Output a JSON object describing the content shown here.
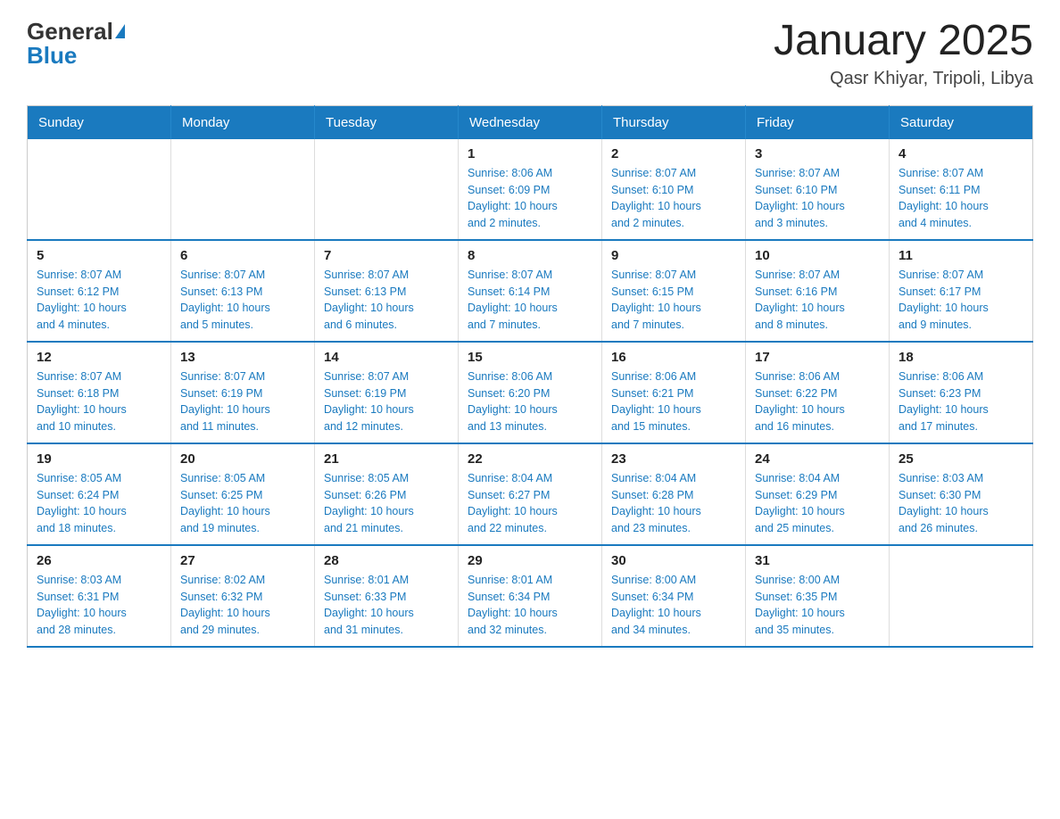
{
  "logo": {
    "text_general": "General",
    "text_blue": "Blue"
  },
  "header": {
    "title": "January 2025",
    "subtitle": "Qasr Khiyar, Tripoli, Libya"
  },
  "weekdays": [
    "Sunday",
    "Monday",
    "Tuesday",
    "Wednesday",
    "Thursday",
    "Friday",
    "Saturday"
  ],
  "weeks": [
    [
      {
        "day": "",
        "info": ""
      },
      {
        "day": "",
        "info": ""
      },
      {
        "day": "",
        "info": ""
      },
      {
        "day": "1",
        "info": "Sunrise: 8:06 AM\nSunset: 6:09 PM\nDaylight: 10 hours\nand 2 minutes."
      },
      {
        "day": "2",
        "info": "Sunrise: 8:07 AM\nSunset: 6:10 PM\nDaylight: 10 hours\nand 2 minutes."
      },
      {
        "day": "3",
        "info": "Sunrise: 8:07 AM\nSunset: 6:10 PM\nDaylight: 10 hours\nand 3 minutes."
      },
      {
        "day": "4",
        "info": "Sunrise: 8:07 AM\nSunset: 6:11 PM\nDaylight: 10 hours\nand 4 minutes."
      }
    ],
    [
      {
        "day": "5",
        "info": "Sunrise: 8:07 AM\nSunset: 6:12 PM\nDaylight: 10 hours\nand 4 minutes."
      },
      {
        "day": "6",
        "info": "Sunrise: 8:07 AM\nSunset: 6:13 PM\nDaylight: 10 hours\nand 5 minutes."
      },
      {
        "day": "7",
        "info": "Sunrise: 8:07 AM\nSunset: 6:13 PM\nDaylight: 10 hours\nand 6 minutes."
      },
      {
        "day": "8",
        "info": "Sunrise: 8:07 AM\nSunset: 6:14 PM\nDaylight: 10 hours\nand 7 minutes."
      },
      {
        "day": "9",
        "info": "Sunrise: 8:07 AM\nSunset: 6:15 PM\nDaylight: 10 hours\nand 7 minutes."
      },
      {
        "day": "10",
        "info": "Sunrise: 8:07 AM\nSunset: 6:16 PM\nDaylight: 10 hours\nand 8 minutes."
      },
      {
        "day": "11",
        "info": "Sunrise: 8:07 AM\nSunset: 6:17 PM\nDaylight: 10 hours\nand 9 minutes."
      }
    ],
    [
      {
        "day": "12",
        "info": "Sunrise: 8:07 AM\nSunset: 6:18 PM\nDaylight: 10 hours\nand 10 minutes."
      },
      {
        "day": "13",
        "info": "Sunrise: 8:07 AM\nSunset: 6:19 PM\nDaylight: 10 hours\nand 11 minutes."
      },
      {
        "day": "14",
        "info": "Sunrise: 8:07 AM\nSunset: 6:19 PM\nDaylight: 10 hours\nand 12 minutes."
      },
      {
        "day": "15",
        "info": "Sunrise: 8:06 AM\nSunset: 6:20 PM\nDaylight: 10 hours\nand 13 minutes."
      },
      {
        "day": "16",
        "info": "Sunrise: 8:06 AM\nSunset: 6:21 PM\nDaylight: 10 hours\nand 15 minutes."
      },
      {
        "day": "17",
        "info": "Sunrise: 8:06 AM\nSunset: 6:22 PM\nDaylight: 10 hours\nand 16 minutes."
      },
      {
        "day": "18",
        "info": "Sunrise: 8:06 AM\nSunset: 6:23 PM\nDaylight: 10 hours\nand 17 minutes."
      }
    ],
    [
      {
        "day": "19",
        "info": "Sunrise: 8:05 AM\nSunset: 6:24 PM\nDaylight: 10 hours\nand 18 minutes."
      },
      {
        "day": "20",
        "info": "Sunrise: 8:05 AM\nSunset: 6:25 PM\nDaylight: 10 hours\nand 19 minutes."
      },
      {
        "day": "21",
        "info": "Sunrise: 8:05 AM\nSunset: 6:26 PM\nDaylight: 10 hours\nand 21 minutes."
      },
      {
        "day": "22",
        "info": "Sunrise: 8:04 AM\nSunset: 6:27 PM\nDaylight: 10 hours\nand 22 minutes."
      },
      {
        "day": "23",
        "info": "Sunrise: 8:04 AM\nSunset: 6:28 PM\nDaylight: 10 hours\nand 23 minutes."
      },
      {
        "day": "24",
        "info": "Sunrise: 8:04 AM\nSunset: 6:29 PM\nDaylight: 10 hours\nand 25 minutes."
      },
      {
        "day": "25",
        "info": "Sunrise: 8:03 AM\nSunset: 6:30 PM\nDaylight: 10 hours\nand 26 minutes."
      }
    ],
    [
      {
        "day": "26",
        "info": "Sunrise: 8:03 AM\nSunset: 6:31 PM\nDaylight: 10 hours\nand 28 minutes."
      },
      {
        "day": "27",
        "info": "Sunrise: 8:02 AM\nSunset: 6:32 PM\nDaylight: 10 hours\nand 29 minutes."
      },
      {
        "day": "28",
        "info": "Sunrise: 8:01 AM\nSunset: 6:33 PM\nDaylight: 10 hours\nand 31 minutes."
      },
      {
        "day": "29",
        "info": "Sunrise: 8:01 AM\nSunset: 6:34 PM\nDaylight: 10 hours\nand 32 minutes."
      },
      {
        "day": "30",
        "info": "Sunrise: 8:00 AM\nSunset: 6:34 PM\nDaylight: 10 hours\nand 34 minutes."
      },
      {
        "day": "31",
        "info": "Sunrise: 8:00 AM\nSunset: 6:35 PM\nDaylight: 10 hours\nand 35 minutes."
      },
      {
        "day": "",
        "info": ""
      }
    ]
  ]
}
